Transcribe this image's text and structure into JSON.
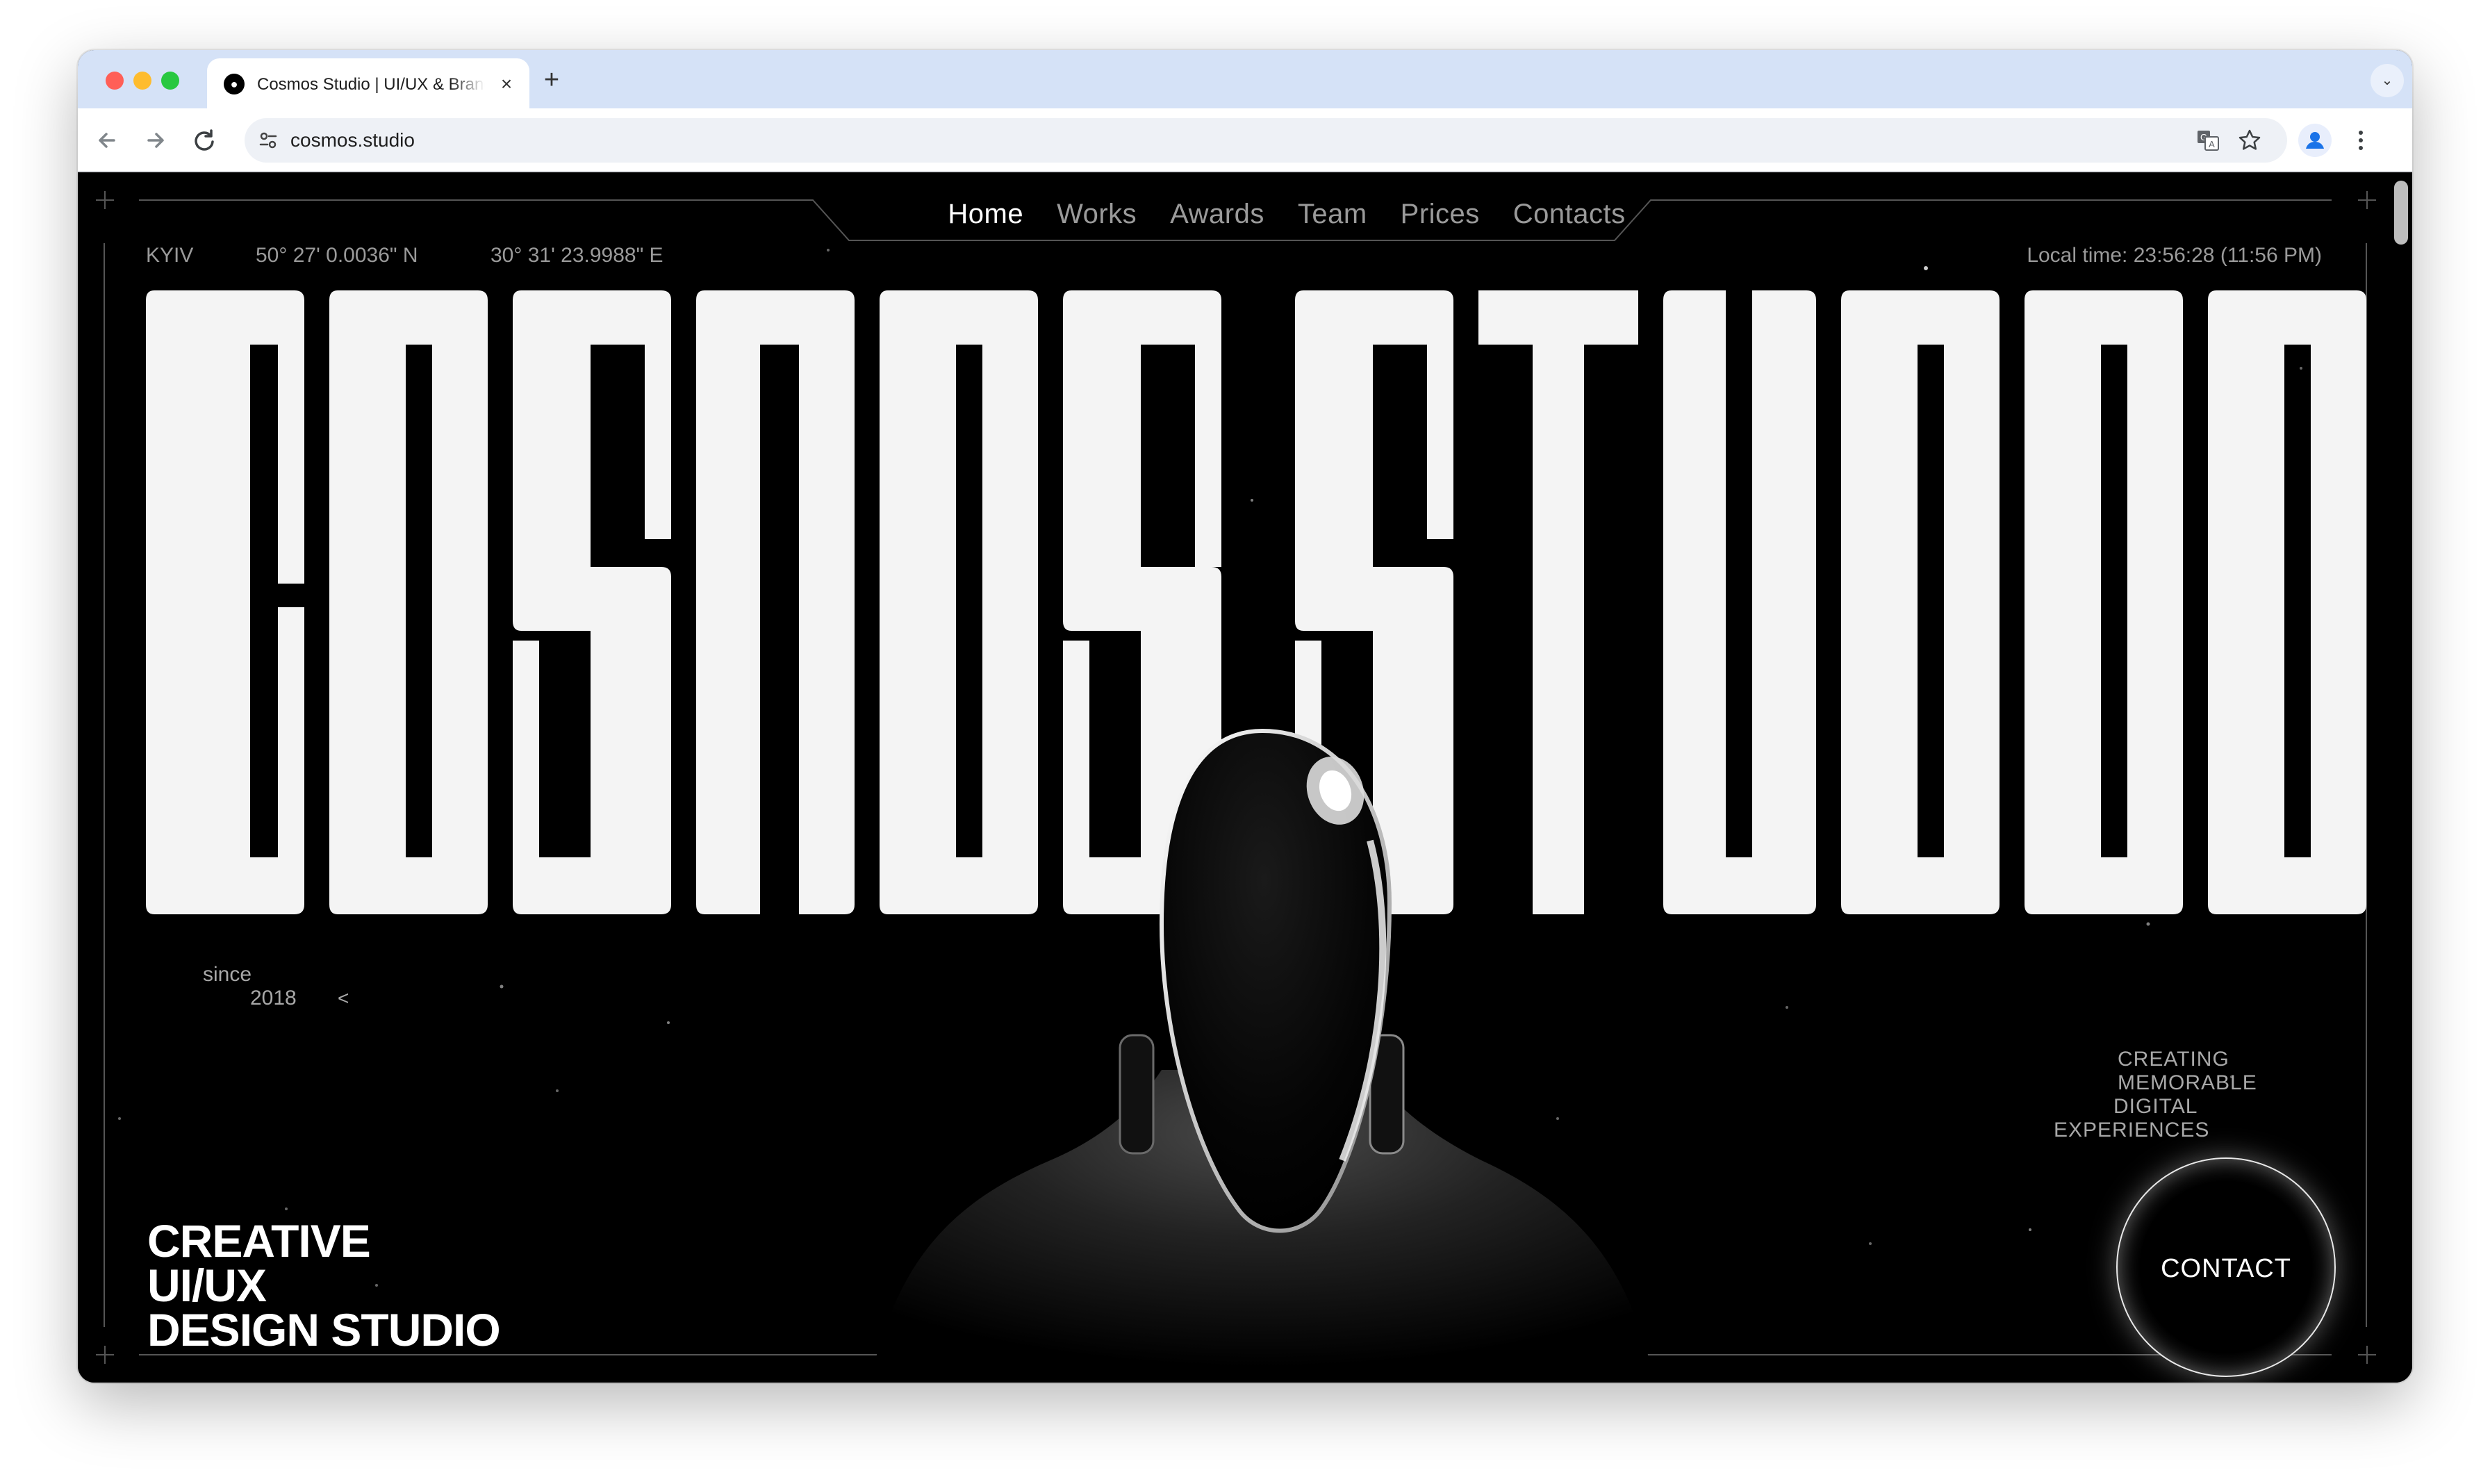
{
  "browser": {
    "tab_title": "Cosmos Studio | UI/UX & Brand",
    "tab_favicon": "●",
    "tab_close": "×",
    "new_tab": "+",
    "tab_menu_icon": "chevron-down-icon",
    "url": "cosmos.studio",
    "back_icon": "arrow-left-icon",
    "forward_icon": "arrow-right-icon",
    "reload_icon": "reload-icon",
    "site_info_icon": "tune-icon",
    "translate_icon": "translate-icon",
    "bookmark_icon": "star-icon",
    "profile_icon": "person-icon",
    "menu_icon": "kebab-icon"
  },
  "nav": {
    "links": [
      "Home",
      "Works",
      "Awards",
      "Team",
      "Prices",
      "Contacts"
    ],
    "active": "Home"
  },
  "meta": {
    "city": "KYIV",
    "latitude": "50° 27' 0.0036\" N",
    "longitude": "30° 31' 23.9988\" E",
    "local_time": "Local time: 23:56:28 (11:56 PM)"
  },
  "hero": {
    "title": "COSMOS STUDIO",
    "since_label": "since",
    "since_year": "2018",
    "since_arrow": "<",
    "tagline": [
      "CREATING",
      "MEMORABLE",
      "DIGITAL",
      "EXPERIENCES"
    ],
    "creative": [
      "CREATIVE",
      "UI/UX",
      "DESIGN STUDIO"
    ],
    "contact_label": "CONTACT"
  },
  "colors": {
    "background": "#000000",
    "title_fill": "#f4f4f4",
    "muted_text": "#9a9a9a",
    "chrome_tabbar": "#d5e2f7"
  }
}
